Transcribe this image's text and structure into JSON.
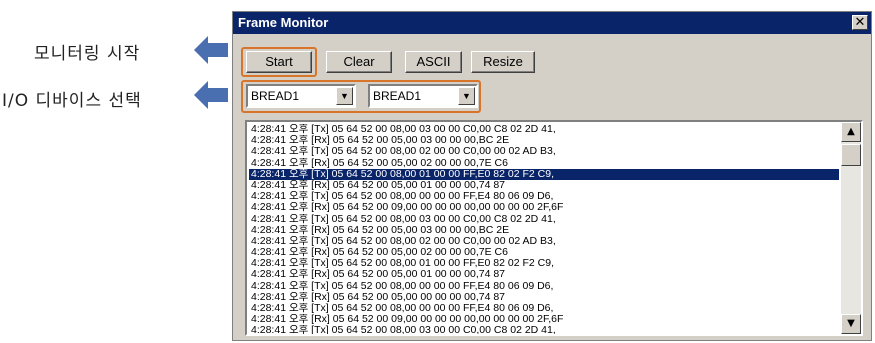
{
  "annotations": {
    "monitor_label": "모니터링 시작",
    "device_label": "I/O 디바이스 선택"
  },
  "window": {
    "title": "Frame Monitor",
    "close_glyph": "✕"
  },
  "toolbar": {
    "start_label": "Start",
    "clear_label": "Clear",
    "ascii_label": "ASCII",
    "resize_label": "Resize"
  },
  "devices": {
    "device1": "BREAD1",
    "device2": "BREAD1",
    "dropdown_glyph": "▼"
  },
  "log": {
    "selected_index": 4,
    "rows": [
      "4:28:41 오후 [Tx] 05 64 52 00 08,00 03 00 00 C0,00 C8 02 2D 41,",
      "4:28:41 오후 [Rx] 05 64 52 00 05,00 03 00 00 00,BC 2E",
      "4:28:41 오후 [Tx] 05 64 52 00 08,00 02 00 00 C0,00 00 02 AD B3,",
      "4:28:41 오후 [Rx] 05 64 52 00 05,00 02 00 00 00,7E C6",
      "4:28:41 오후 [Tx] 05 64 52 00 08,00 01 00 00 FF,E0 82 02 F2 C9,",
      "4:28:41 오후 [Rx] 05 64 52 00 05,00 01 00 00 00,74 87",
      "4:28:41 오후 [Tx] 05 64 52 00 08,00 00 00 00 FF,E4 80 06 09 D6,",
      "4:28:41 오후 [Rx] 05 64 52 00 09,00 00 00 00 00,00 00 00 00 2F,6F",
      "4:28:41 오후 [Tx] 05 64 52 00 08,00 03 00 00 C0,00 C8 02 2D 41,",
      "4:28:41 오후 [Rx] 05 64 52 00 05,00 03 00 00 00,BC 2E",
      "4:28:41 오후 [Tx] 05 64 52 00 08,00 02 00 00 C0,00 00 02 AD B3,",
      "4:28:41 오후 [Rx] 05 64 52 00 05,00 02 00 00 00,7E C6",
      "4:28:41 오후 [Tx] 05 64 52 00 08,00 01 00 00 FF,E0 82 02 F2 C9,",
      "4:28:41 오후 [Rx] 05 64 52 00 05,00 01 00 00 00,74 87",
      "4:28:41 오후 [Tx] 05 64 52 00 08,00 00 00 00 FF,E4 80 06 09 D6,",
      "4:28:41 오후 [Rx] 05 64 52 00 05,00 00 00 00 00,74 87",
      "4:28:41 오후 [Tx] 05 64 52 00 08,00 00 00 00 FF,E4 80 06 09 D6,",
      "4:28:41 오후 [Rx] 05 64 52 00 09,00 00 00 00 00,00 00 00 00 2F,6F",
      "4:28:41 오후 [Tx] 05 64 52 00 08,00 03 00 00 C0,00 C8 02 2D 41,"
    ]
  },
  "scroll": {
    "up_glyph": "▲",
    "down_glyph": "▼"
  },
  "colors": {
    "title_bar": "#0a246a",
    "highlight_box": "#d9742b",
    "arrow": "#4a6fb0",
    "window_face": "#d4d0c8"
  }
}
